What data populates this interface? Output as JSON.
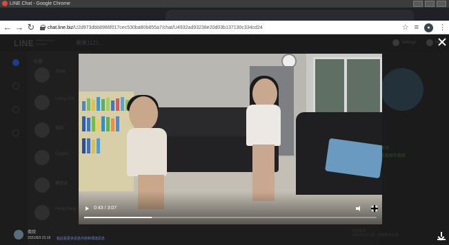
{
  "window": {
    "title": "LINE Chat - Google Chrome"
  },
  "address_bar": {
    "url_domain": "chat.line.biz",
    "url_path": "/U2d973dbb8986f017cec530ba80b855a7/chat/U4932ad93238e20d03b137130c334cd24"
  },
  "app": {
    "logo": "LINE",
    "logo_sub": "Official Account Manager",
    "account_name": "果果1121...",
    "header_right": [
      "Settings",
      "Help"
    ],
    "list_heading": "全部",
    "chats": [
      {
        "name": "Jorge",
        "preview": "..."
      },
      {
        "name": "Lenny Chi",
        "preview": "..."
      },
      {
        "name": "瑪莉",
        "preview": "..."
      },
      {
        "name": "Cooper",
        "preview": "..."
      },
      {
        "name": "賽班卓",
        "preview": "..."
      },
      {
        "name": "Peng Peng",
        "preview": "..."
      }
    ],
    "profile_link": "查看聊天檔案",
    "profile_name": "果然"
  },
  "bottom_note": {
    "sender": "奕欣",
    "date": "2021/6/3 21:15",
    "link_text": "點此看更多訊息內容和傳送訊息",
    "right_text": "註記事項",
    "right_text2": "2021/6/3 21:15 · 查看聊天記錄"
  },
  "video": {
    "current_time": "0:43",
    "duration": "3:07",
    "progress_fraction": 0.23
  }
}
